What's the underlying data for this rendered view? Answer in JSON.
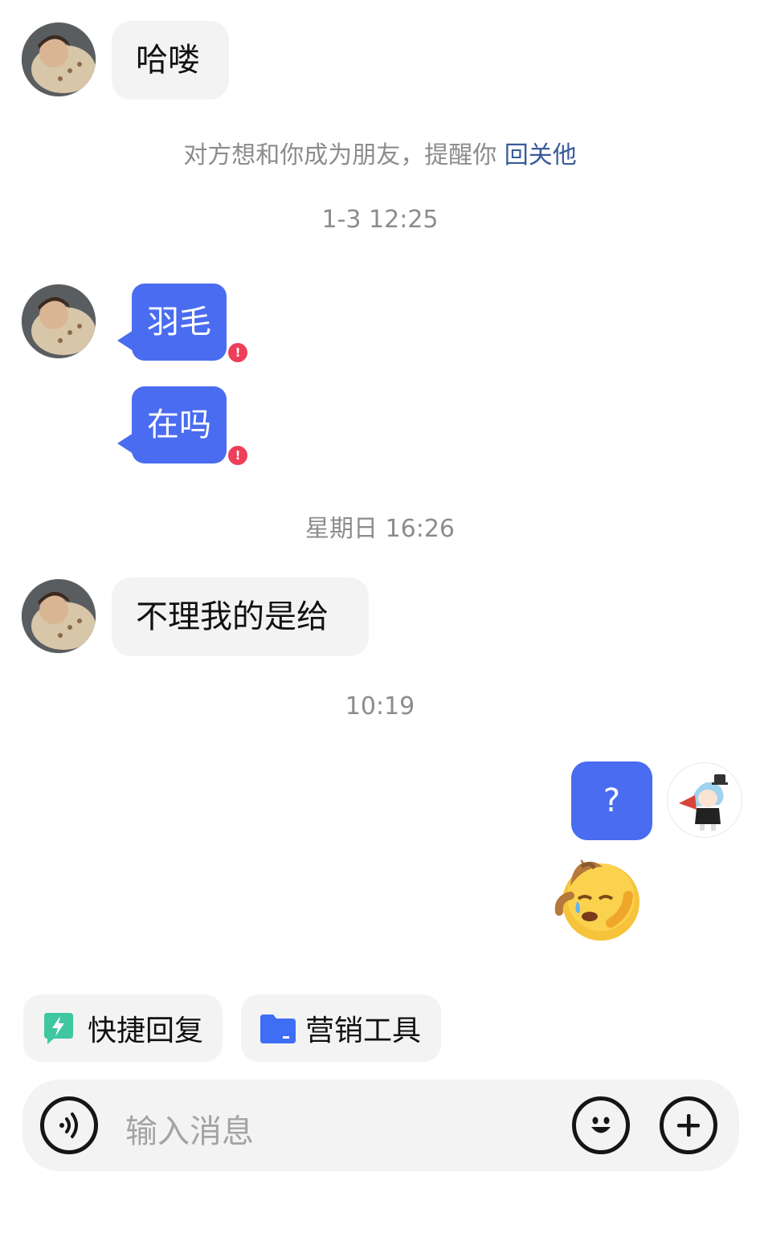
{
  "messages": {
    "m1": "哈喽",
    "m2": "羽毛",
    "m3": "在吗",
    "m4": "不理我的是给",
    "m5": "?",
    "error_badge": "!"
  },
  "system": {
    "friend_notice": "对方想和你成为朋友，提醒你",
    "follow_back_link": "回关他"
  },
  "timestamps": {
    "t1": "1-3 12:25",
    "t2": "星期日 16:26",
    "t3": "10:19"
  },
  "quick_actions": {
    "quick_reply": "快捷回复",
    "marketing_tools": "营销工具"
  },
  "composer": {
    "placeholder": "输入消息"
  },
  "colors": {
    "bubble_blue": "#4a6cf0",
    "error_red": "#ee3f5a",
    "bubble_gray": "#f3f3f4",
    "link": "#3a5a9a"
  },
  "icons": {
    "voice": "voice-icon",
    "emoji": "emoji-icon",
    "plus": "plus-icon",
    "quick_reply": "lightning-icon",
    "marketing": "folder-icon",
    "sticker": "crying-emoji-sticker"
  }
}
